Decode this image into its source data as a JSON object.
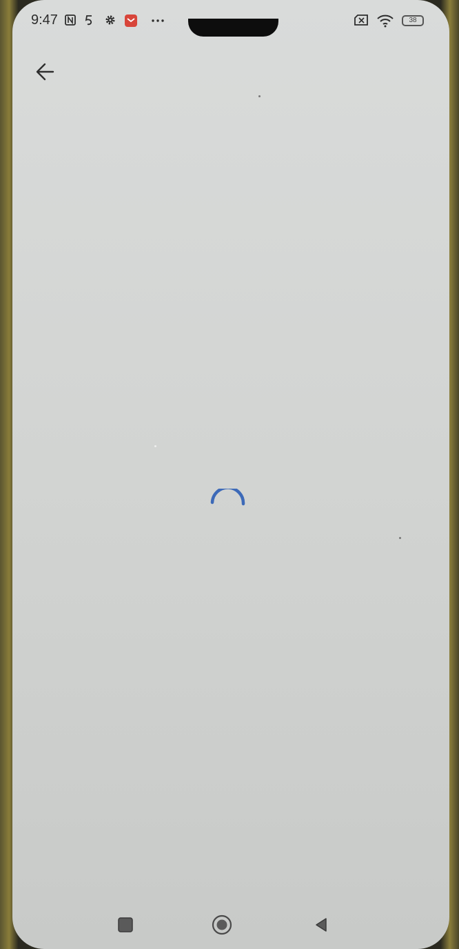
{
  "status_bar": {
    "time": "9:47",
    "battery": "38",
    "icons": [
      "nfc-icon",
      "sim-5-icon",
      "gear-icon",
      "mail-app-icon",
      "more-dots-icon",
      "sim-off-icon",
      "wifi-icon",
      "battery-icon"
    ]
  },
  "toolbar": {
    "back_icon": "arrow-left-icon"
  },
  "content": {
    "state": "loading",
    "spinner_color": "#3d6ab8"
  },
  "nav_bar": {
    "recents_icon": "square-icon",
    "home_icon": "circle-icon",
    "back_icon": "triangle-left-icon"
  }
}
